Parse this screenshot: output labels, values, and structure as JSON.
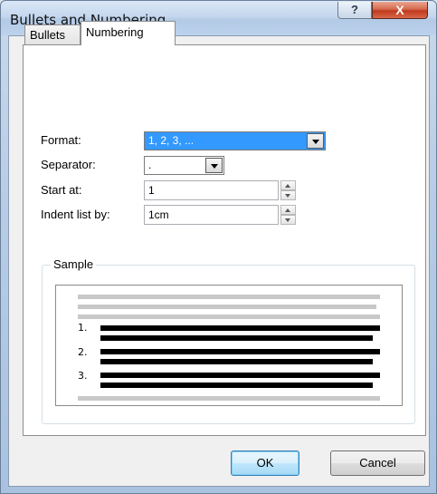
{
  "window": {
    "title": "Bullets and Numbering",
    "help_glyph": "?",
    "close_glyph": "X"
  },
  "tabs": [
    {
      "label": "Bullets",
      "selected": false
    },
    {
      "label": "Numbering",
      "selected": true
    }
  ],
  "form": {
    "format_label": "Format:",
    "format_value": "1, 2, 3, ...",
    "separator_label": "Separator:",
    "separator_value": ".",
    "start_label": "Start at:",
    "start_value": "1",
    "indent_label": "Indent list by:",
    "indent_value": "1cm"
  },
  "sample": {
    "group_label": "Sample",
    "numbers": [
      "1.",
      "2.",
      "3."
    ]
  },
  "buttons": {
    "ok": "OK",
    "cancel": "Cancel"
  },
  "colors": {
    "selection": "#3399ff",
    "close_button": "#c0391c"
  }
}
